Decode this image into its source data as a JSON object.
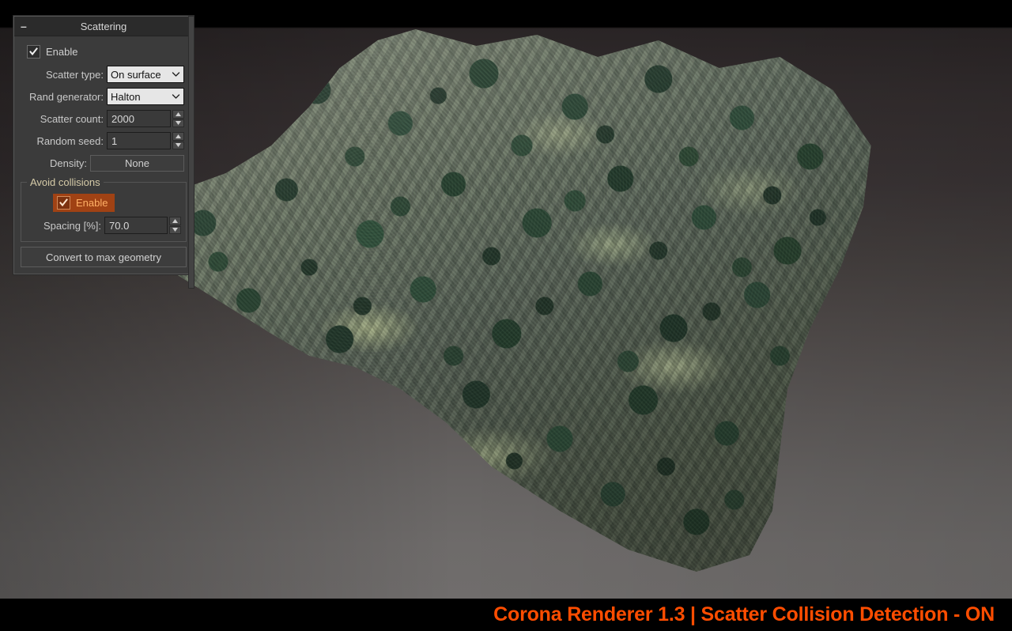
{
  "viewport": {
    "scene_description": "3D forested terrain patch with scattered trees"
  },
  "panel": {
    "rollout": {
      "title": "Scattering",
      "collapse_glyph": "–"
    },
    "enable": {
      "label": "Enable",
      "checked": true
    },
    "scatter_type": {
      "label": "Scatter type:",
      "value": "On surface"
    },
    "rand_generator": {
      "label": "Rand generator:",
      "value": "Halton"
    },
    "scatter_count": {
      "label": "Scatter count:",
      "value": "2000"
    },
    "random_seed": {
      "label": "Random seed:",
      "value": "1"
    },
    "density": {
      "label": "Density:",
      "value": "None"
    },
    "avoid_collisions": {
      "title": "Avoid collisions",
      "enable_label": "Enable",
      "enable_checked": true,
      "spacing_label": "Spacing [%]:",
      "spacing_value": "70.0",
      "highlight_bg": "#a04214",
      "highlight_text": "#ffb066"
    },
    "convert_button": {
      "label": "Convert to max geometry"
    }
  },
  "caption": {
    "text": "Corona  Renderer 1.3 | Scatter Collision Detection - ON",
    "color": "#ff4d00"
  }
}
